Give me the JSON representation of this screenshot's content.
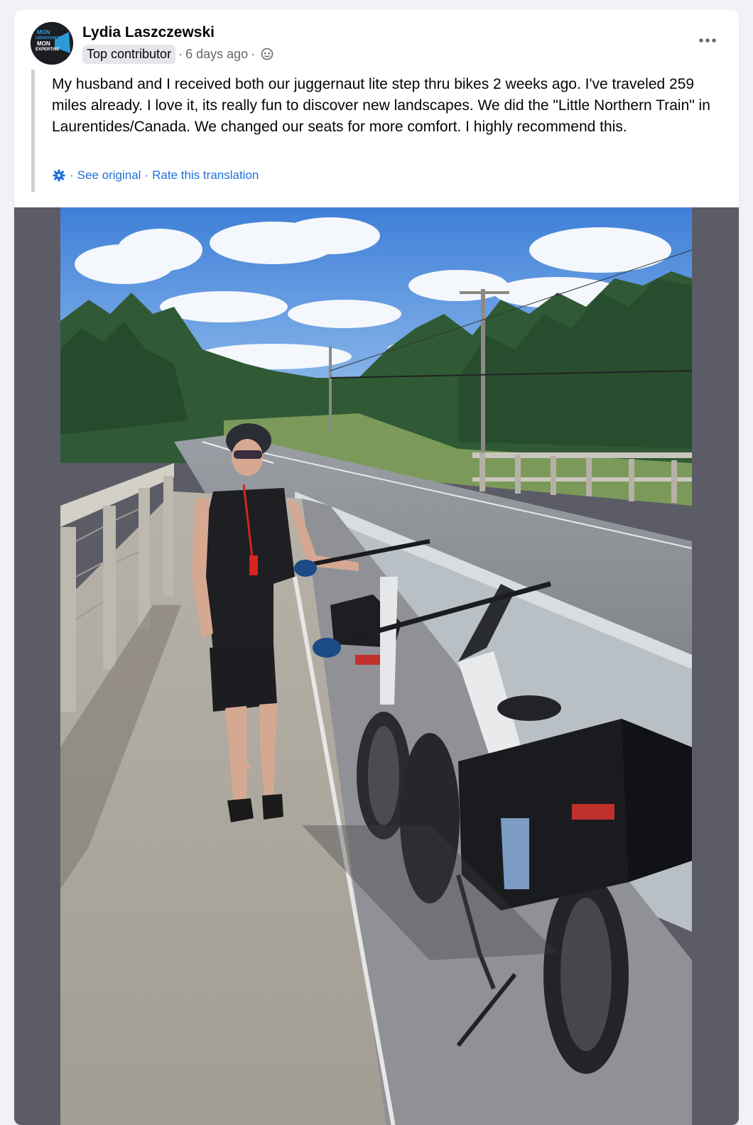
{
  "post": {
    "author_name": "Lydia Laszczewski",
    "badge": "Top contributor",
    "timestamp": "6 days ago",
    "separator": "·",
    "audience_icon": "public-globe-icon",
    "more_icon": "more-options-icon",
    "text": "My husband and I received both our juggernaut lite step thru bikes 2 weeks ago. I've traveled 259 miles already. I love it, its really fun to discover new landscapes. We did the \"Little Northern Train\" in Laurentides/Canada. We changed our seats for more comfort. I highly recommend this.",
    "avatar": {
      "line1": "MON",
      "line2": "DÉPARTEMENT",
      "line3": "MON",
      "line4": "EXPERTISE"
    }
  },
  "translation": {
    "icon": "gear-icon",
    "see_original": "See original",
    "rate": "Rate this translation",
    "separator": "·"
  },
  "colors": {
    "link": "#216fdb",
    "badge_bg": "#e4e6eb",
    "photo_frame": "#5b5c66",
    "page_bg": "#f0f2f5"
  }
}
